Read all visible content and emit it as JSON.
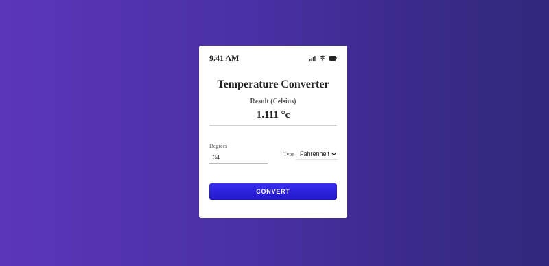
{
  "status_bar": {
    "time": "9.41 AM",
    "icons": [
      "signal-icon",
      "wifi-icon",
      "battery-icon"
    ]
  },
  "converter": {
    "title": "Temperature Converter",
    "result_label": "Result (Celsius)",
    "result_value": "1.111 °c",
    "degrees_label": "Degrees",
    "degrees_value": "34",
    "type_label": "Type",
    "type_selected": "Fahrenheit",
    "convert_label": "CONVERT"
  },
  "colors": {
    "background_start": "#5b36b8",
    "background_end": "#33287c",
    "button_accent": "#2a20e0",
    "card": "#ffffff"
  }
}
